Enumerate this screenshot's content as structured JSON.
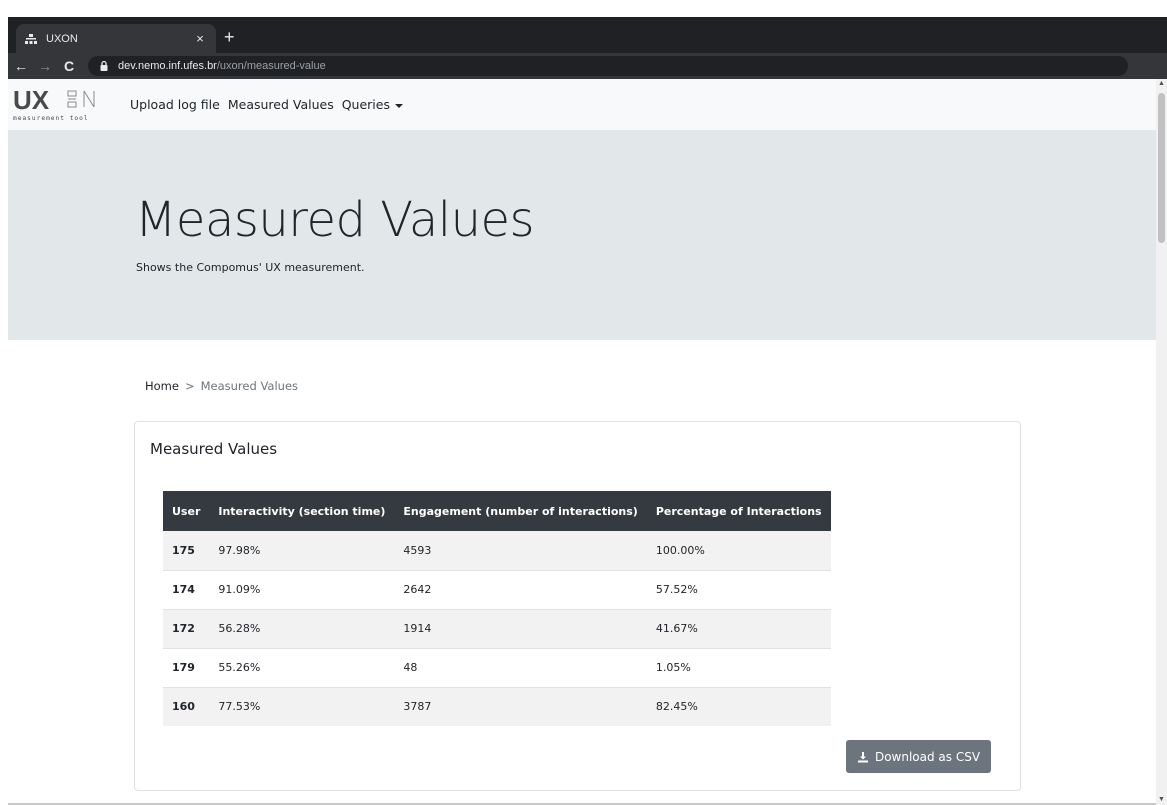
{
  "browser": {
    "tab_title": "UXON",
    "tab_close": "×",
    "new_tab": "+",
    "back": "←",
    "forward": "→",
    "reload": "C",
    "url_host": "dev.nemo.inf.ufes.br",
    "url_path": "/uxon/measured-value",
    "icons": [
      "uxon-favicon-icon",
      "lock-icon",
      "back-icon",
      "forward-icon",
      "reload-icon"
    ]
  },
  "navbar": {
    "logo_text": "UX",
    "logo_subtext": "measurement tool",
    "links": [
      {
        "label": "Upload log file"
      },
      {
        "label": "Measured Values"
      },
      {
        "label": "Queries"
      }
    ]
  },
  "jumbotron": {
    "title": "Measured Values",
    "lead": "Shows the Compomus' UX measurement."
  },
  "breadcrumb": {
    "home": "Home",
    "separator": ">",
    "current": "Measured Values"
  },
  "card": {
    "title": "Measured Values",
    "table": {
      "headers": [
        "User",
        "Interactivity (section time)",
        "Engagement (number of interactions)",
        "Percentage of Interactions"
      ],
      "rows": [
        [
          "175",
          "97.98%",
          "4593",
          "100.00%"
        ],
        [
          "174",
          "91.09%",
          "2642",
          "57.52%"
        ],
        [
          "172",
          "56.28%",
          "1914",
          "41.67%"
        ],
        [
          "179",
          "55.26%",
          "48",
          "1.05%"
        ],
        [
          "160",
          "77.53%",
          "3787",
          "82.45%"
        ]
      ]
    },
    "download_label": "Download as CSV",
    "download_icon": "download-icon"
  },
  "colors": {
    "table_header_bg": "#343a40",
    "button_bg": "#6c757d",
    "jumbotron_bg": "#e2e7ea",
    "navbar_bg": "#f8f9fa"
  }
}
